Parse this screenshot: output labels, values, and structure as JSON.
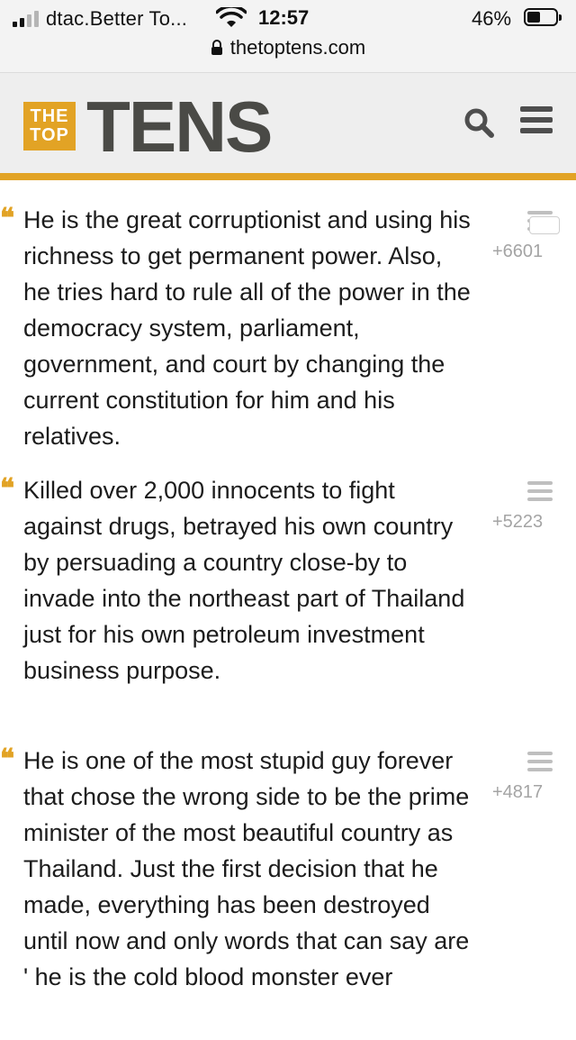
{
  "status_bar": {
    "carrier": "dtac.Better To...",
    "time": "12:57",
    "battery": "46%",
    "battery_level": 0.46,
    "url": "thetoptens.com"
  },
  "header": {
    "logo_top": "THE",
    "logo_bottom": "TOP",
    "logo_word": "TENS",
    "accent_color": "#e2a325"
  },
  "comments": [
    {
      "text": "He is the great corruptionist and using his richness to get permanent power. Also, he tries hard to rule all of the power in the democracy system, parliament, government, and court by changing the current constitution for him and his relatives.",
      "score": "+6601"
    },
    {
      "text": "Killed over 2,000 innocents to fight against drugs, betrayed his own country by persuading a country close-by to invade into the northeast part of Thailand just for his own petroleum investment business purpose.",
      "score": "+5223"
    },
    {
      "text": "He is one of the most stupid guy forever that chose the wrong side to be the prime minister of the most beautiful country as Thailand. Just the first decision that he made, everything has been destroyed until now and only words that can say are ' he is the cold blood monster ever",
      "score": "+4817"
    }
  ],
  "icons": {
    "quote": "open-quote-icon",
    "menu": "hamburger-menu-icon",
    "search": "search-icon",
    "lock": "lock-icon",
    "wifi": "wifi-icon"
  }
}
